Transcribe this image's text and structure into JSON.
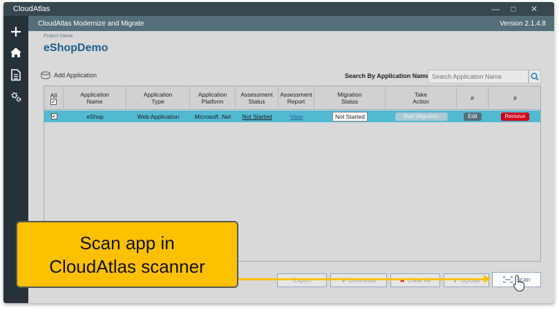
{
  "window": {
    "title": "CloudAtlas"
  },
  "header": {
    "app_title": "CloudAtlas Modernize and Migrate",
    "version": "Version 2.1.4.8"
  },
  "project": {
    "label": "Project Name",
    "name": "eShopDemo"
  },
  "toolbar": {
    "add_application": "Add Application",
    "search_label": "Search By Application Name",
    "search_placeholder": "Search Application Name"
  },
  "table": {
    "columns": [
      {
        "line1": "All",
        "line2": ""
      },
      {
        "line1": "Application",
        "line2": "Name"
      },
      {
        "line1": "Application",
        "line2": "Type"
      },
      {
        "line1": "Application",
        "line2": "Platform"
      },
      {
        "line1": "Assessment",
        "line2": "Status"
      },
      {
        "line1": "Assessment",
        "line2": "Report"
      },
      {
        "line1": "Migration",
        "line2": "Status"
      },
      {
        "line1": "Take",
        "line2": "Action"
      },
      {
        "line1": "#",
        "line2": ""
      },
      {
        "line1": "#",
        "line2": ""
      }
    ],
    "rows": [
      {
        "name": "eShop",
        "type": "Web Application",
        "platform": "Microsoft .Net",
        "assessment_status": "Not Started",
        "assessment_report": "View",
        "migration_status": "Not Started",
        "action": "Start Migration",
        "edit": "Edit",
        "remove": "Remove"
      }
    ]
  },
  "footer": {
    "export": "Export",
    "download": "Download",
    "clear_all": "Clear All",
    "upload": "Upload",
    "scan": "Scan"
  },
  "callout": {
    "line1": "Scan app in",
    "line2": "CloudAtlas scanner"
  },
  "colors": {
    "row_highlight": "#53b9d2",
    "remove_button": "#d0021b",
    "edit_button": "#546e7a",
    "callout": "#ffc000",
    "project_name": "#1a5c8f"
  }
}
